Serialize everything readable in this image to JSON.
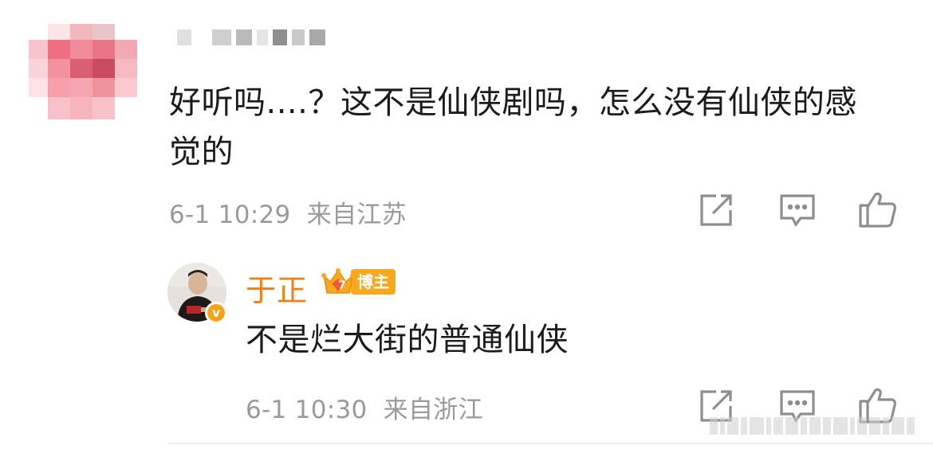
{
  "comment": {
    "text": "好听吗....？这不是仙侠剧吗，怎么没有仙侠的感觉的",
    "time": "6-1 10:29",
    "location": "来自江苏",
    "actions": {
      "forward_icon": "share-icon",
      "comment_icon": "comment-icon",
      "like_icon": "thumbs-up-icon"
    }
  },
  "reply": {
    "author": "于正",
    "badge_level": "7",
    "badge_label": "博主",
    "verified_mark": "v",
    "text": "不是烂大街的普通仙侠",
    "time": "6-1 10:30",
    "location": "来自浙江",
    "actions": {
      "forward_icon": "share-icon",
      "comment_icon": "comment-icon",
      "like_icon": "thumbs-up-icon"
    }
  },
  "colors": {
    "author_name": "#ef7f16",
    "meta_text": "#9a9a9a",
    "badge": "#f6a91c",
    "icon": "#9a9a9a"
  }
}
